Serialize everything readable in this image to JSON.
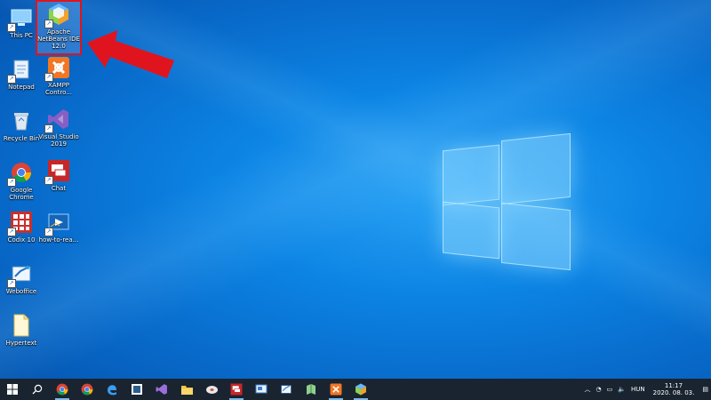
{
  "desktop": {
    "icons": [
      {
        "label": "This PC"
      },
      {
        "label": "Apache NetBeans IDE 12.0"
      },
      {
        "label": "Notepad"
      },
      {
        "label": "XAMPP Contro..."
      },
      {
        "label": "Recycle Bin"
      },
      {
        "label": "Visual Studio 2019"
      },
      {
        "label": "Google Chrome"
      },
      {
        "label": "Chat"
      },
      {
        "label": "Codix 10"
      },
      {
        "label": "how-to-rea..."
      },
      {
        "label": "Weboffice"
      },
      {
        "label": "Hypertext"
      }
    ]
  },
  "taskbar": {
    "tray": {
      "language": "HUN",
      "time": "11:17",
      "date": "2020. 08. 03."
    }
  },
  "colors": {
    "accent": "#0a78dc",
    "highlight": "#e0141e",
    "taskbar": "#1a2430"
  }
}
